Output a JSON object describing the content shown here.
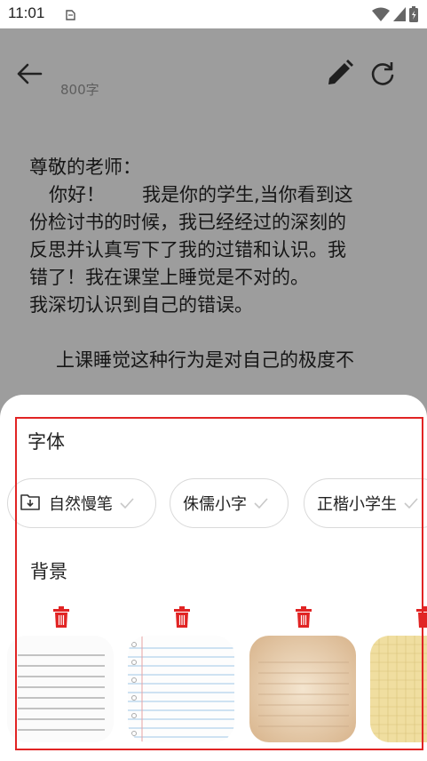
{
  "status_bar": {
    "time": "11:01"
  },
  "header": {
    "word_count": "800字"
  },
  "content": {
    "salutation": "尊敬的老师：",
    "para1_lines": [
      "你好！　　我是你的学生,当你看到这",
      "份检讨书的时候，我已经经过的深刻的",
      "反思并认真写下了我的过错和认识。我",
      "错了！我在课堂上睡觉是不对的。",
      "我深切认识到自己的错误。"
    ],
    "para2_line": "上课睡觉这种行为是对自己的极度不"
  },
  "font_panel": {
    "title": "字体",
    "fonts": [
      {
        "label": "自然慢笔"
      },
      {
        "label": "侏儒小字"
      },
      {
        "label": "正楷小学生"
      }
    ]
  },
  "background_panel": {
    "title": "背景",
    "backgrounds": [
      "lined-white",
      "notebook-blue",
      "aged-paper",
      "yellow-graph"
    ]
  },
  "colors": {
    "accent_red": "#e12424",
    "overlay_gray": "#9d9d9d"
  }
}
